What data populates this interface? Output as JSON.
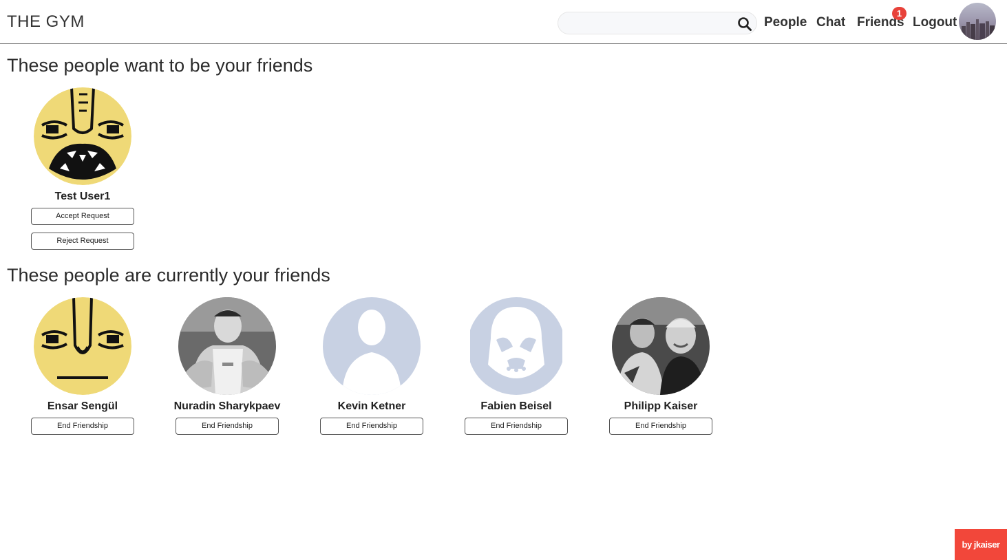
{
  "header": {
    "brand": "THE GYM",
    "search": {
      "placeholder": "",
      "value": ""
    },
    "nav": {
      "people": "People",
      "chat": "Chat",
      "friends": "Friends",
      "logout": "Logout"
    },
    "friends_badge": "1"
  },
  "requests": {
    "title": "These people want to be your friends",
    "items": [
      {
        "name": "Test User1",
        "accept_label": "Accept Request",
        "reject_label": "Reject Request"
      }
    ]
  },
  "friends": {
    "title": "These people are currently your friends",
    "end_label": "End Friendship",
    "items": [
      {
        "name": "Ensar Sengül"
      },
      {
        "name": "Nuradin Sharykpaev"
      },
      {
        "name": "Kevin Ketner"
      },
      {
        "name": "Fabien Beisel"
      },
      {
        "name": "Philipp Kaiser"
      }
    ]
  },
  "credit": "by jkaiser",
  "colors": {
    "badge": "#e8423a",
    "credit_bg": "#f2473a",
    "placeholder_avatar": "#c8d1e3",
    "emoji_yellow": "#efd977"
  }
}
